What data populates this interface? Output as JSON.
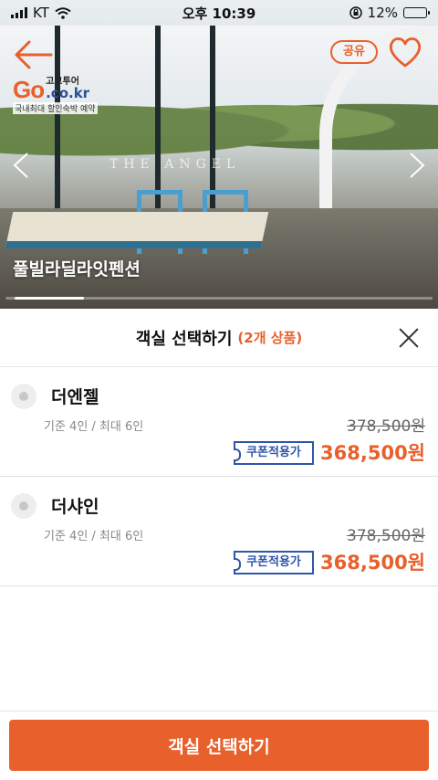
{
  "status_bar": {
    "carrier": "KT",
    "time": "오후 10:39",
    "battery_percent": "12%",
    "battery_level": 0.12
  },
  "hero": {
    "property_name": "풀빌라딜라잇펜션",
    "watermark": "THE ANGEL",
    "share_label": "공유",
    "slide_position": 0.05,
    "brand": {
      "logo_mark": "Go",
      "small_text": "고코투어",
      "domain": ".co.kr",
      "tagline": "국내최대 할인숙박 예약"
    }
  },
  "sheet": {
    "title": "객실 선택하기",
    "count": "(2개 상품)"
  },
  "rooms": [
    {
      "name": "더엔젤",
      "capacity": "기준 4인 / 최대 6인",
      "original_price": "378,500원",
      "coupon_label": "쿠폰적용가",
      "price": "368,500원"
    },
    {
      "name": "더샤인",
      "capacity": "기준 4인 / 최대 6인",
      "original_price": "378,500원",
      "coupon_label": "쿠폰적용가",
      "price": "368,500원"
    }
  ],
  "footer": {
    "button_label": "객실 선택하기"
  },
  "colors": {
    "accent": "#e8602c",
    "coupon": "#2f57a8"
  },
  "icons": [
    "back-arrow-icon",
    "heart-icon",
    "chevron-left-icon",
    "chevron-right-icon",
    "close-icon",
    "wifi-icon",
    "signal-icon",
    "battery-icon",
    "rotation-lock-icon"
  ]
}
